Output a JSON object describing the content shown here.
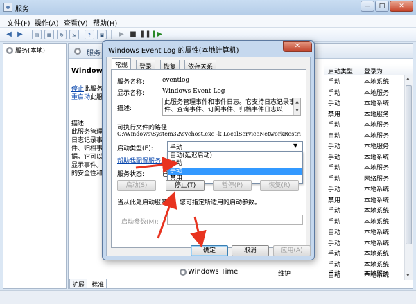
{
  "window": {
    "title": "服务"
  },
  "menu": [
    "文件(F)",
    "操作(A)",
    "查看(V)",
    "帮助(H)"
  ],
  "tree": {
    "root": "服务(本地)"
  },
  "pane": {
    "header": "服务",
    "service_short": "Windows",
    "links": {
      "stop": "停止",
      "stop_rest": "此服务",
      "restart": "重启动",
      "restart_rest": "此服务"
    },
    "desc_lines": [
      "描述:",
      "此服务管理事",
      "日志记录事",
      "件、归档事",
      "据。它可以",
      "显示事件。",
      "的安全性和"
    ],
    "columns": [
      "启动类型",
      "登录为"
    ],
    "rows": [
      [
        "手动",
        "本地系统"
      ],
      [
        "手动",
        "本地服务"
      ],
      [
        "手动",
        "本地系统"
      ],
      [
        "禁用",
        "本地服务"
      ],
      [
        "手动",
        "本地服务"
      ],
      [
        "自动",
        "本地服务"
      ],
      [
        "手动",
        "本地服务"
      ],
      [
        "手动",
        "本地系统"
      ],
      [
        "手动",
        "本地服务"
      ],
      [
        "手动",
        "网络服务"
      ],
      [
        "手动",
        "本地系统"
      ],
      [
        "禁用",
        "本地系统"
      ],
      [
        "手动",
        "本地系统"
      ],
      [
        "手动",
        "本地系统"
      ],
      [
        "自动",
        "本地系统"
      ],
      [
        "手动",
        "本地系统"
      ],
      [
        "手动",
        "本地系统"
      ],
      [
        "手动",
        "本地系统"
      ],
      [
        "自动",
        "本地系统"
      ]
    ],
    "wt_row": {
      "name": "Windows Time",
      "status": "维护",
      "startup": "手动",
      "logon": "本地服务"
    },
    "bottom_tabs": [
      "扩展",
      "标准"
    ]
  },
  "dialog": {
    "title": "Windows Event Log 的属性(本地计算机)",
    "close": "✕",
    "tabs": [
      "常规",
      "登录",
      "恢复",
      "依存关系"
    ],
    "service_name_label": "服务名称:",
    "service_name": "eventlog",
    "display_name_label": "显示名称:",
    "display_name": "Windows Event Log",
    "desc_label": "描述:",
    "desc_text": "此服务管理事件和事件日志。它支持日志记录事件、查询事件、订阅事件、归档事件日志以",
    "path_label": "可执行文件的路径:",
    "path": "C:\\Windows\\System32\\svchost.exe -k LocalServiceNetworkRestri",
    "startup_label": "启动类型(E):",
    "startup_value": "手动",
    "startup_options": [
      "自动(延迟启动)",
      "自动",
      "手动",
      "禁用"
    ],
    "startup_selected": 2,
    "help_link": "帮助我配置服务启",
    "status_label": "服务状态:",
    "status_value": "已启动",
    "buttons": {
      "start": "启动(S)",
      "stop": "停止(T)",
      "pause": "暂停(P)",
      "resume": "恢复(R)"
    },
    "hint": "当从此处启动服务时，您可指定所适用的启动参数。",
    "param_label": "启动参数(M):",
    "param_value": "",
    "ok": "确定",
    "cancel": "取消",
    "apply": "应用(A)"
  },
  "colors": {
    "arrow": "#e8331f",
    "selection": "#3399ff"
  }
}
